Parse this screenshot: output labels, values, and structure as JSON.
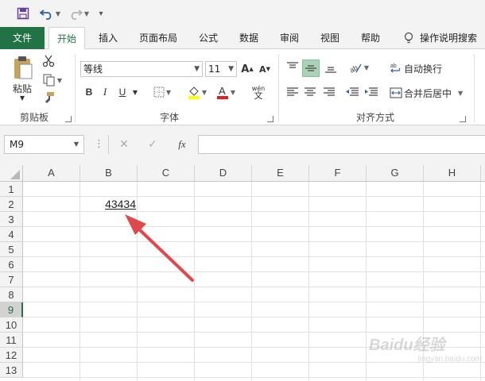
{
  "quick_access": {
    "save_icon": "save-icon",
    "undo_icon": "undo-icon",
    "redo_icon": "redo-icon",
    "customize_icon": "customize-icon"
  },
  "tabs": [
    "文件",
    "开始",
    "插入",
    "页面布局",
    "公式",
    "数据",
    "审阅",
    "视图",
    "帮助"
  ],
  "tell_me": "操作说明搜索",
  "clipboard": {
    "paste": "粘贴",
    "label": "剪贴板"
  },
  "font": {
    "name": "等线",
    "size": "11",
    "label": "字体",
    "bold": "B",
    "italic": "I",
    "underline": "U",
    "phonetic_top": "wén",
    "phonetic_bottom": "文"
  },
  "alignment": {
    "wrap": "自动换行",
    "merge": "合并后居中",
    "label": "对齐方式"
  },
  "name_box": "M9",
  "formula_bar": {
    "cancel": "✕",
    "enter": "✓",
    "fx": "fx",
    "value": ""
  },
  "columns": [
    "A",
    "B",
    "C",
    "D",
    "E",
    "F",
    "G",
    "H"
  ],
  "rows": [
    "1",
    "2",
    "3",
    "4",
    "5",
    "6",
    "7",
    "8",
    "9",
    "10",
    "11",
    "12",
    "13"
  ],
  "selected_row": "9",
  "cells": {
    "B2": "43434"
  },
  "colors": {
    "accent": "#217346",
    "arrow": "#e0494b",
    "ribbon_bg": "#f3f3f3"
  },
  "watermark": {
    "brand": "Baidu经验",
    "url": "jingyan.baidu.com"
  }
}
